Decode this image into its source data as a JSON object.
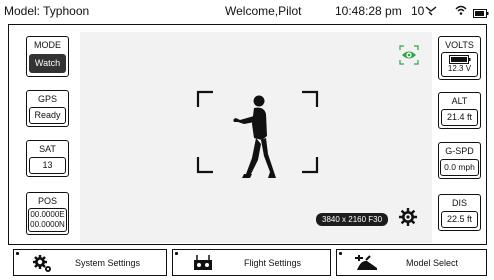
{
  "status_bar": {
    "model": "Model: Typhoon",
    "welcome": "Welcome,Pilot",
    "time": "10:48:28 pm",
    "signal": "10"
  },
  "left_panels": {
    "mode": {
      "label": "MODE",
      "value": "Watch"
    },
    "gps": {
      "label": "GPS",
      "value": "Ready"
    },
    "sat": {
      "label": "SAT",
      "value": "13"
    },
    "pos": {
      "label": "POS",
      "value_line1": "00.0000E",
      "value_line2": "00.0000N"
    }
  },
  "right_panels": {
    "volts": {
      "label": "VOLTS",
      "value": "12.3 V"
    },
    "alt": {
      "label": "ALT",
      "value": "21.4 ft"
    },
    "gspd": {
      "label": "G-SPD",
      "value": "0.0 mph"
    },
    "dis": {
      "label": "DIS",
      "value": "22.5 ft"
    }
  },
  "camera": {
    "resolution": "3840 x 2160 F30",
    "accent_color": "#2aa54a"
  },
  "bottom_buttons": {
    "system_settings": "System Settings",
    "flight_settings": "Flight Settings",
    "model_select": "Model Select"
  },
  "icons": {
    "top": [
      "signal-icon",
      "wifi-icon",
      "battery-icon"
    ],
    "camera": [
      "eye-icon",
      "focus-corners-icon",
      "gear-icon"
    ],
    "bottom": [
      "gear-icon",
      "controller-icon",
      "drone-icon"
    ]
  }
}
